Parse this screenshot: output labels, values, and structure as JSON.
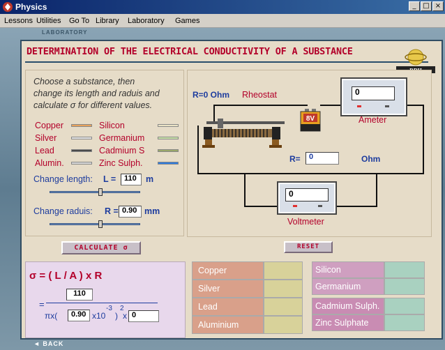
{
  "window": {
    "title": "Physics",
    "controls": [
      "_",
      "□",
      "×"
    ]
  },
  "menu": [
    "Lessons",
    "Utilities",
    "Go To",
    "Library",
    "Laboratory",
    "Games"
  ],
  "frame": {
    "section_label": "LABORATORY",
    "back_label": "◄ BACK"
  },
  "heading": "DETERMINATION OF THE ELECTRICAL CONDUCTIVITY OF A SUBSTANCE",
  "logo_text": "RDH",
  "instructions": [
    "Choose a substance, then",
    "change its length and raduis and",
    "calculate σ for different values."
  ],
  "substances_left": [
    {
      "name": "Copper",
      "color": "#e8a25a"
    },
    {
      "name": "Silver",
      "color": "#e4e4e4"
    },
    {
      "name": "Lead",
      "color": "#4a4a4a"
    },
    {
      "name": "Alumin.",
      "color": "#d8d8d8"
    }
  ],
  "substances_right": [
    {
      "name": "Silicon",
      "color": "#ece4c6"
    },
    {
      "name": "Germanium",
      "color": "#c9e3a6"
    },
    {
      "name": "Cadmium S",
      "color": "#9aa86a"
    },
    {
      "name": "Zinc Sulph.",
      "color": "#2d7ce0"
    }
  ],
  "length": {
    "label": "Change length:",
    "var": "L =",
    "value": "110",
    "unit": "m",
    "slider_fraction": 0.56
  },
  "radius": {
    "label": "Change raduis:",
    "var": "R =",
    "value": "0.90",
    "unit": "mm",
    "slider_fraction": 0.56
  },
  "circuit": {
    "r_label": "R=0  Ohm",
    "rheostat_label": "Rheostat",
    "battery_label": "8V",
    "ammeter_value": "0",
    "ammeter_label": "Ameter",
    "resistance_prefix": "R=",
    "resistance_value": "0",
    "resistance_unit": "Ohm",
    "voltmeter_value": "0",
    "voltmeter_label": "Voltmeter"
  },
  "buttons": {
    "calculate": "CALCULATE σ",
    "reset": "RESET"
  },
  "formula": {
    "lhs": "σ = ( L / A ) x R",
    "equals": "=",
    "numerator": "110",
    "pi_text": "πx(",
    "radius_value": "0.90",
    "times_ten": "x10",
    "exp": "-3",
    "close": ")",
    "square": "2",
    "times": "x",
    "r_value": "0"
  },
  "results_left": [
    {
      "name": "Copper",
      "value": ""
    },
    {
      "name": "Silver",
      "value": ""
    },
    {
      "name": "Lead",
      "value": ""
    },
    {
      "name": "Aluminium",
      "value": ""
    }
  ],
  "results_right": [
    {
      "name": "Silicon",
      "value": ""
    },
    {
      "name": "Germanium",
      "value": ""
    },
    {
      "name": "Cadmium Sulph.",
      "value": ""
    },
    {
      "name": "Zinc Sulphate",
      "value": ""
    }
  ],
  "colors": {
    "accent": "#b3002a",
    "blue_text": "#1d3c9e",
    "frame": "#5e7c90",
    "left_table": "#d9a08a",
    "right_table_top": "#cf9fc0",
    "right_table_bottom": "#c98cb3",
    "value_cell": "#d8d29a",
    "value_cell_right": "#a9d1c0"
  }
}
